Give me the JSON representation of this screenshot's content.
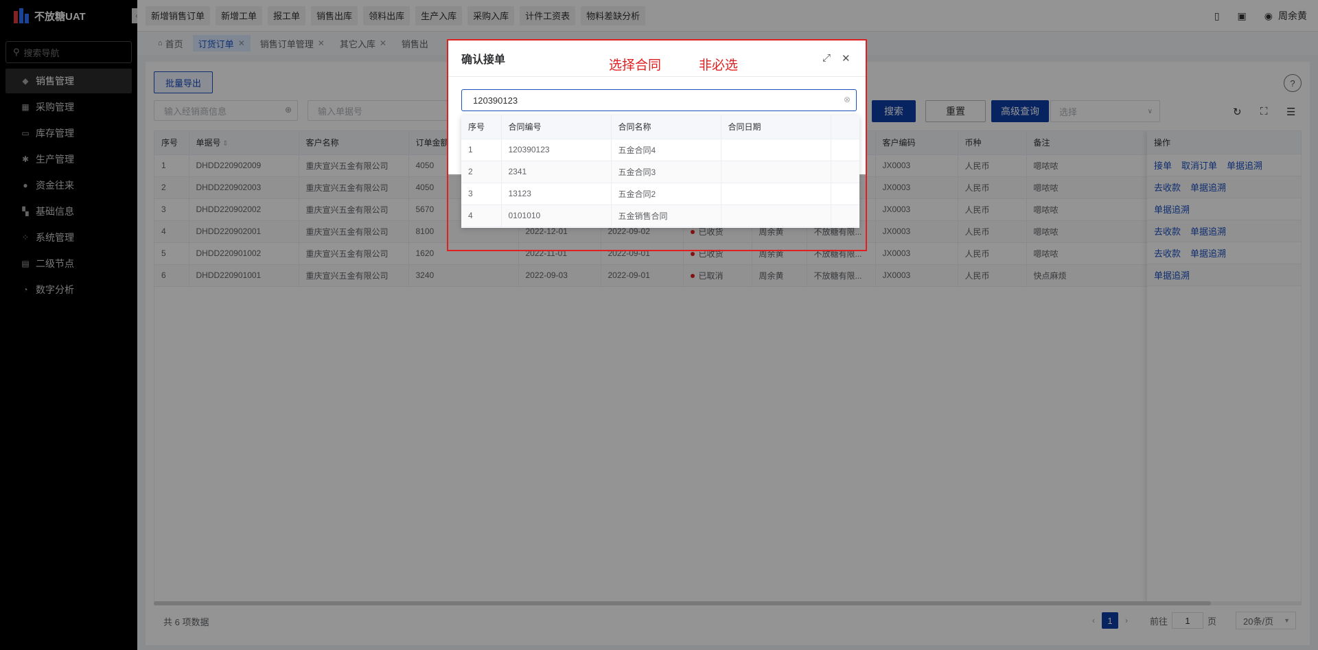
{
  "app": {
    "title": "不放糖UAT"
  },
  "sidebar": {
    "search_placeholder": "搜索导航",
    "items": [
      {
        "label": "销售管理",
        "icon": "tag-icon",
        "glyph": "◆"
      },
      {
        "label": "采购管理",
        "icon": "cart-icon",
        "glyph": "▦"
      },
      {
        "label": "库存管理",
        "icon": "box-icon",
        "glyph": "▭"
      },
      {
        "label": "生产管理",
        "icon": "production-icon",
        "glyph": "✱"
      },
      {
        "label": "资金往来",
        "icon": "money-icon",
        "glyph": "●"
      },
      {
        "label": "基础信息",
        "icon": "grid-icon",
        "glyph": "▚"
      },
      {
        "label": "系统管理",
        "icon": "settings-icon",
        "glyph": "⁘"
      },
      {
        "label": "二级节点",
        "icon": "document-icon",
        "glyph": "▤"
      },
      {
        "label": "数字分析",
        "icon": "pie-chart-icon",
        "glyph": "◔"
      }
    ]
  },
  "topbar": {
    "quick_links": [
      "新增销售订单",
      "新增工单",
      "报工单",
      "销售出库",
      "领料出库",
      "生产入库",
      "采购入库",
      "计件工资表",
      "物料差缺分析"
    ],
    "user": "周余黄"
  },
  "tabs": [
    {
      "label": "首页"
    },
    {
      "label": "订货订单"
    },
    {
      "label": "销售订单管理"
    },
    {
      "label": "其它入库"
    },
    {
      "label": "销售出"
    }
  ],
  "toolbar": {
    "batch_export": "批量导出",
    "dealer_placeholder": "输入经销商信息",
    "order_no_placeholder": "输入单据号",
    "search": "搜索",
    "reset": "重置",
    "advanced": "高级查询",
    "select_placeholder": "选择"
  },
  "table": {
    "headers": [
      "序号",
      "单据号",
      "客户名称",
      "订单金额",
      "",
      "",
      "",
      "",
      "",
      "客户编码",
      "币种",
      "备注"
    ],
    "op_header": "操作",
    "rows": [
      {
        "no": "1",
        "doc": "DHDD220902009",
        "customer": "重庆宣兴五金有限公司",
        "amount": "4050",
        "d1": "",
        "d2": "",
        "status": "",
        "person": "",
        "company": "",
        "code": "JX0003",
        "currency": "人民币",
        "remark": "嗯哝哝",
        "ops": [
          "接单",
          "取消订单",
          "单据追溯"
        ]
      },
      {
        "no": "2",
        "doc": "DHDD220902003",
        "customer": "重庆宣兴五金有限公司",
        "amount": "4050",
        "d1": "",
        "d2": "",
        "status": "",
        "person": "",
        "company": "",
        "code": "JX0003",
        "currency": "人民币",
        "remark": "嗯哝哝",
        "ops": [
          "去收款",
          "单据追溯"
        ]
      },
      {
        "no": "3",
        "doc": "DHDD220902002",
        "customer": "重庆宣兴五金有限公司",
        "amount": "5670",
        "d1": "",
        "d2": "",
        "status": "",
        "person": "",
        "company": "",
        "code": "JX0003",
        "currency": "人民币",
        "remark": "嗯哝哝",
        "ops": [
          "单据追溯"
        ]
      },
      {
        "no": "4",
        "doc": "DHDD220902001",
        "customer": "重庆宣兴五金有限公司",
        "amount": "8100",
        "d1": "2022-12-01",
        "d2": "2022-09-02",
        "status": "已收货",
        "person": "周余黄",
        "company": "不放糖有限...",
        "code": "JX0003",
        "currency": "人民币",
        "remark": "嗯哝哝",
        "ops": [
          "去收款",
          "单据追溯"
        ]
      },
      {
        "no": "5",
        "doc": "DHDD220901002",
        "customer": "重庆宣兴五金有限公司",
        "amount": "1620",
        "d1": "2022-11-01",
        "d2": "2022-09-01",
        "status": "已收货",
        "person": "周余黄",
        "company": "不放糖有限...",
        "code": "JX0003",
        "currency": "人民币",
        "remark": "嗯哝哝",
        "ops": [
          "去收款",
          "单据追溯"
        ]
      },
      {
        "no": "6",
        "doc": "DHDD220901001",
        "customer": "重庆宣兴五金有限公司",
        "amount": "3240",
        "d1": "2022-09-03",
        "d2": "2022-09-01",
        "status": "已取消",
        "person": "周余黄",
        "company": "不放糖有限...",
        "code": "JX0003",
        "currency": "人民币",
        "remark": "快点麻烦",
        "ops": [
          "单据追溯"
        ]
      }
    ]
  },
  "footer": {
    "total": "共 6 项数据",
    "current_page": "1",
    "goto_label": "前往",
    "goto_value": "1",
    "page_unit": "页",
    "page_size": "20条/页"
  },
  "dialog": {
    "title": "确认接单",
    "annotation_1": "选择合同",
    "annotation_2": "非必选",
    "input_value": "120390123",
    "dropdown": {
      "headers": [
        "序号",
        "合同编号",
        "合同名称",
        "合同日期",
        ""
      ],
      "rows": [
        {
          "no": "1",
          "code": "120390123",
          "name": "五金合同4",
          "date": ""
        },
        {
          "no": "2",
          "code": "2341",
          "name": "五金合同3",
          "date": ""
        },
        {
          "no": "3",
          "code": "13123",
          "name": "五金合同2",
          "date": ""
        },
        {
          "no": "4",
          "code": "0101010",
          "name": "五金销售合同",
          "date": ""
        }
      ]
    }
  },
  "colors": {
    "primary": "#0d3fa8",
    "annotation": "#e02020",
    "sidebar_bg": "#000000"
  }
}
